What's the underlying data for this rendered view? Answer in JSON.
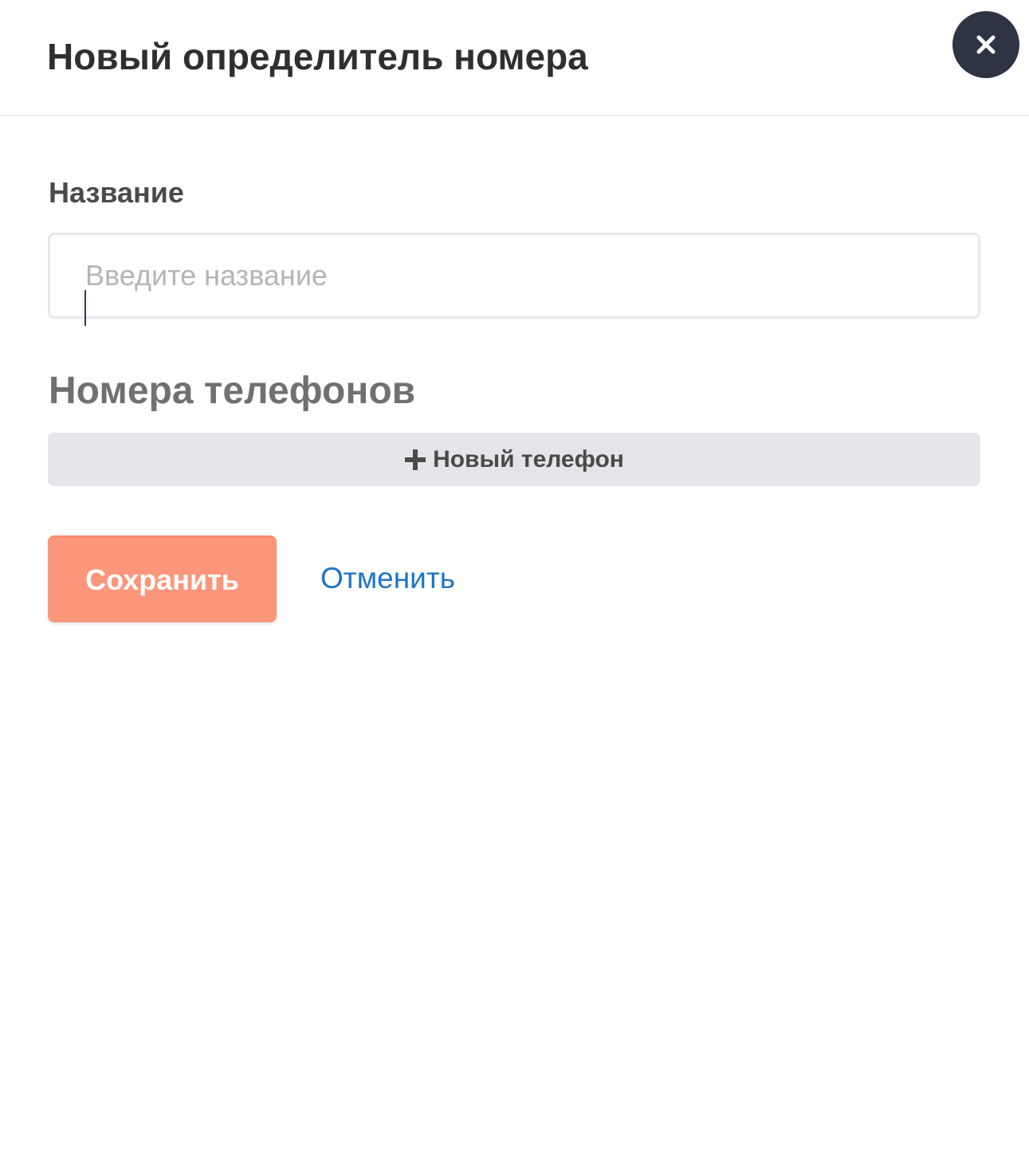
{
  "dialog": {
    "title": "Новый определитель номера",
    "close_icon": "close-icon"
  },
  "form": {
    "name_label": "Название",
    "name_input": {
      "value": "",
      "placeholder": "Введите название"
    },
    "phones_heading": "Номера телефонов",
    "add_phone": {
      "icon": "plus-icon",
      "label": "Новый телефон"
    }
  },
  "actions": {
    "save_label": "Сохранить",
    "cancel_label": "Отменить"
  },
  "colors": {
    "close_button_bg": "#2e3444",
    "save_button_bg": "#fb967a",
    "cancel_link": "#1f74c7",
    "add_phone_bg": "#e3e5e8"
  }
}
